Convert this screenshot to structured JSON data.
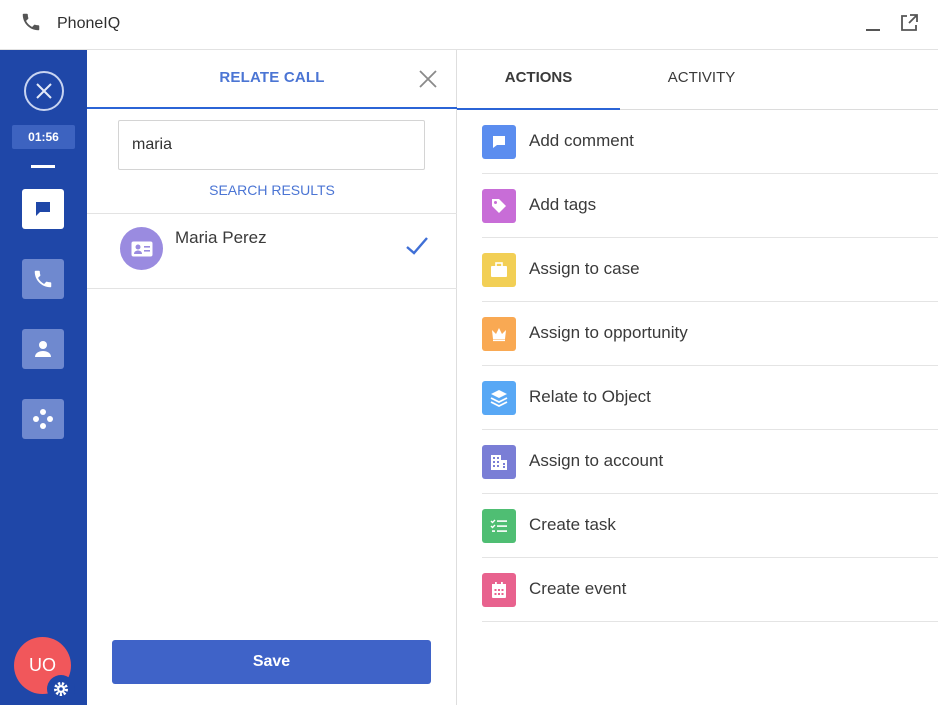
{
  "app": {
    "title": "PhoneIQ"
  },
  "rail": {
    "timer": "01:56",
    "avatar_initials": "UO",
    "buttons": [
      {
        "name": "comment",
        "icon": "chat-bubble-icon",
        "active": true
      },
      {
        "name": "phone",
        "icon": "phone-icon",
        "active": false
      },
      {
        "name": "contact",
        "icon": "person-icon",
        "active": false
      },
      {
        "name": "apps",
        "icon": "dots-grid-icon",
        "active": false
      }
    ]
  },
  "relate_panel": {
    "title": "RELATE CALL",
    "search_value": "maria",
    "results_label": "SEARCH RESULTS",
    "results": [
      {
        "name": "Maria Perez",
        "selected": true
      }
    ],
    "save_label": "Save"
  },
  "actions_panel": {
    "tabs": [
      {
        "label": "ACTIONS",
        "active": true
      },
      {
        "label": "ACTIVITY",
        "active": false
      }
    ],
    "items": [
      {
        "label": "Add comment",
        "icon": "comment-icon",
        "color": "#5b8def"
      },
      {
        "label": "Add tags",
        "icon": "tag-icon",
        "color": "#c86dd7"
      },
      {
        "label": "Assign to case",
        "icon": "briefcase-icon",
        "color": "#f2cf55"
      },
      {
        "label": "Assign to opportunity",
        "icon": "crown-icon",
        "color": "#f9a953"
      },
      {
        "label": "Relate to Object",
        "icon": "layers-icon",
        "color": "#58a8f5"
      },
      {
        "label": "Assign to account",
        "icon": "building-icon",
        "color": "#7a7ed6"
      },
      {
        "label": "Create task",
        "icon": "checklist-icon",
        "color": "#4fbe73"
      },
      {
        "label": "Create event",
        "icon": "calendar-icon",
        "color": "#e8628e"
      }
    ]
  },
  "colors": {
    "accent": "#2b64d6",
    "rail": "#1f47a8",
    "save_button": "#3f63c8",
    "avatar": "#f1575b",
    "contact_avatar": "#9a8be0"
  }
}
